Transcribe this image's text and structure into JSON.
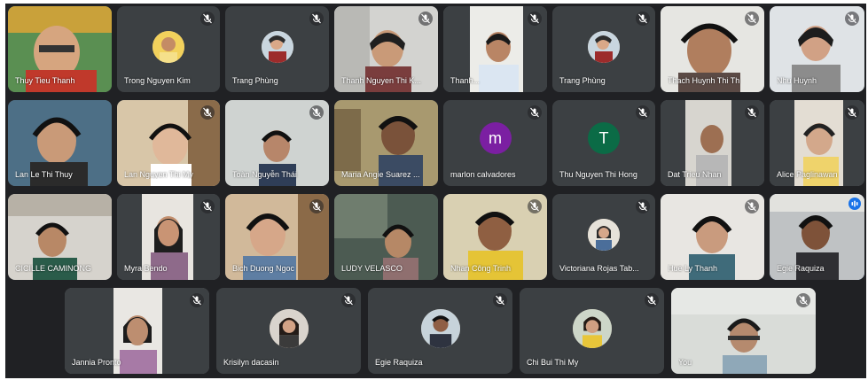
{
  "participants": [
    {
      "name": "Thuy Tieu Thanh",
      "muted": false
    },
    {
      "name": "Trong Nguyen Kim",
      "muted": true
    },
    {
      "name": "Trang Phùng",
      "muted": true
    },
    {
      "name": "Thanh Nguyen Thi K...",
      "muted": true
    },
    {
      "name": "Thanh...",
      "muted": true
    },
    {
      "name": "Trang Phùng",
      "muted": true
    },
    {
      "name": "Thach Huynh Thi Th",
      "muted": true
    },
    {
      "name": "Nhu Huynh",
      "muted": true
    },
    {
      "name": "Lan Le Thi Thuy",
      "muted": false
    },
    {
      "name": "Lan Nguyen Thi My",
      "muted": true
    },
    {
      "name": "Toàn Nguyễn Thái",
      "muted": true
    },
    {
      "name": "Maria Angie Suarez ...",
      "muted": true
    },
    {
      "name": "marlon calvadores",
      "muted": true,
      "initial": "m",
      "color": "#7b1fa2"
    },
    {
      "name": "Thu Nguyen Thi Hong",
      "muted": true,
      "initial": "T",
      "color": "#0b6b46"
    },
    {
      "name": "Dat Trieu Nhan",
      "muted": true
    },
    {
      "name": "Alice Paglinawan",
      "muted": true
    },
    {
      "name": "CICILLE CAMINONG",
      "muted": false
    },
    {
      "name": "Myra Bendo",
      "muted": true
    },
    {
      "name": "Bich Duong Ngoc",
      "muted": true
    },
    {
      "name": "LUDY VELASCO",
      "muted": false
    },
    {
      "name": "Nhan Công Trinh",
      "muted": true
    },
    {
      "name": "Victoriana Rojas Tab...",
      "muted": true
    },
    {
      "name": "Hue Ly Thanh",
      "muted": true
    },
    {
      "name": "Egie Raquiza",
      "muted": false,
      "speaking": true
    },
    {
      "name": "Jannia Pronto",
      "muted": true
    },
    {
      "name": "Krisilyn dacasin",
      "muted": true
    },
    {
      "name": "Egie Raquiza",
      "muted": true
    },
    {
      "name": "Chi Bui Thi My",
      "muted": true
    },
    {
      "name": "You",
      "muted": true
    }
  ],
  "colors": {
    "background": "#202124",
    "tile": "#3c4043",
    "active_border": "#8ab4f8",
    "speaking": "#1a73e8"
  },
  "icons": {
    "muted": "mic-off-icon",
    "speaking": "audio-level-icon"
  }
}
